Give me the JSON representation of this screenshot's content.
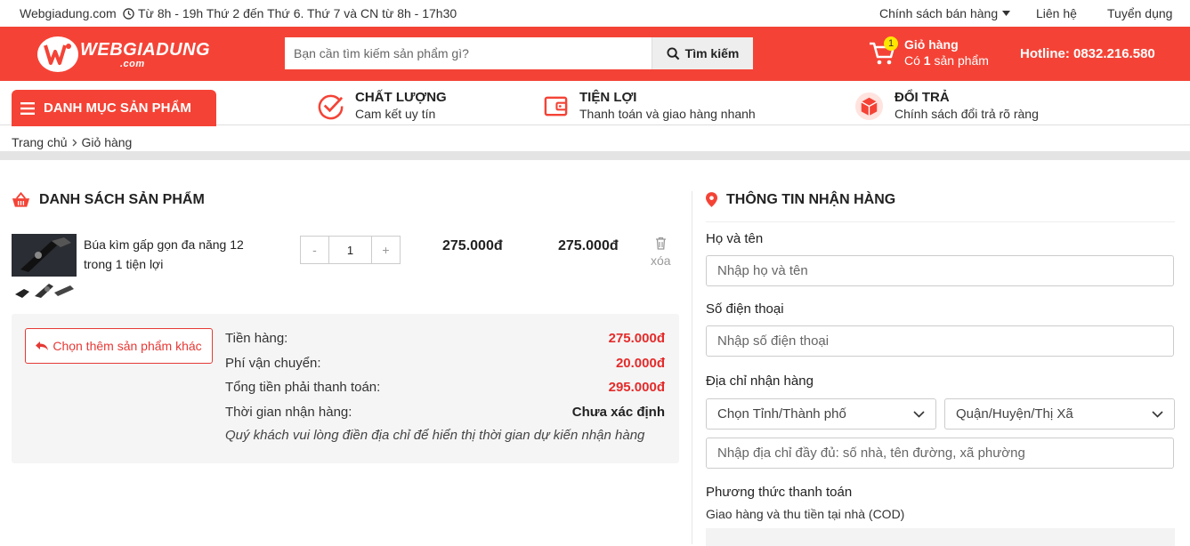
{
  "topbar": {
    "site": "Webgiadung.com",
    "hours": "Từ 8h - 19h Thứ 2 đến Thứ 6. Thứ 7 và CN từ 8h - 17h30",
    "policy": "Chính sách bán hàng",
    "contact": "Liên hệ",
    "jobs": "Tuyển dụng"
  },
  "header": {
    "logo_text": "WEBGIADUNG",
    "logo_sub": ".com",
    "search_placeholder": "Bạn cần tìm kiếm sản phẩm gì?",
    "search_button": "Tìm kiếm",
    "cart_title": "Giỏ hàng",
    "cart_prefix": "Có",
    "cart_count": "1",
    "cart_suffix": "sản phẩm",
    "cart_badge": "1",
    "hotline": "Hotline: 0832.216.580"
  },
  "nav": {
    "category_button": "DANH MỤC SẢN PHẨM",
    "features": [
      {
        "title": "CHẤT LƯỢNG",
        "subtitle": "Cam kết uy tín"
      },
      {
        "title": "TIỆN LỢI",
        "subtitle": "Thanh toán và giao hàng nhanh"
      },
      {
        "title": "ĐỔI TRẢ",
        "subtitle": "Chính sách đổi trả rõ ràng"
      }
    ]
  },
  "breadcrumb": {
    "home": "Trang chủ",
    "current": "Giỏ hàng"
  },
  "cart": {
    "heading": "DANH SÁCH SẢN PHẨM",
    "items": [
      {
        "name": "Búa kìm gấp gọn đa năng 12 trong 1 tiện lợi",
        "qty": "1",
        "price": "275.000đ",
        "total": "275.000đ",
        "delete": "xóa",
        "minus": "-",
        "plus": "+"
      }
    ],
    "more_button": "Chọn thêm sản phẩm khác",
    "summary": {
      "subtotal_label": "Tiền hàng:",
      "subtotal": "275.000đ",
      "shipping_label": "Phí vận chuyển:",
      "shipping": "20.000đ",
      "grand_label": "Tổng tiền phải thanh toán:",
      "grand": "295.000đ",
      "time_label": "Thời gian nhận hàng:",
      "time": "Chưa xác định",
      "note": "Quý khách vui lòng điền địa chỉ để hiển thị thời gian dự kiến nhận hàng"
    }
  },
  "shipping_form": {
    "heading": "THÔNG TIN NHẬN HÀNG",
    "name_label": "Họ và tên",
    "name_placeholder": "Nhập họ và tên",
    "phone_label": "Số điện thoại",
    "phone_placeholder": "Nhập số điện thoại",
    "address_label": "Địa chỉ nhận hàng",
    "province": "Chọn Tỉnh/Thành phố",
    "district": "Quận/Huyện/Thị Xã",
    "address_placeholder": "Nhập địa chỉ đầy đủ: số nhà, tên đường, xã phường",
    "payment_label": "Phương thức thanh toán",
    "payment_value": "Giao hàng và thu tiền tại nhà (COD)"
  },
  "colors": {
    "brand": "#f44336",
    "price": "#e52b2b",
    "badge": "#ffe600"
  }
}
